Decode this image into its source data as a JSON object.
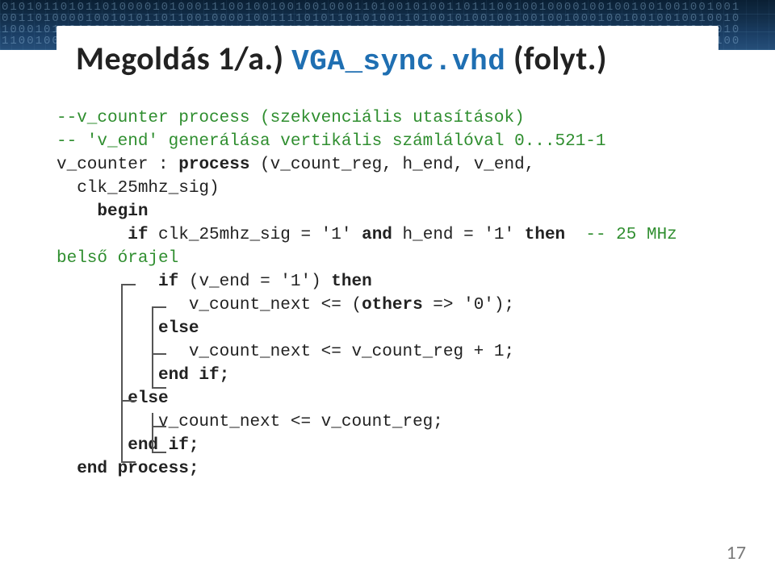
{
  "banner": {
    "digit_rows": [
      "0101011010110100001010001110010010010010001101001010011011100100100001001001001001001001",
      "0011010000100101011011001000010011110101101010011010010100100100100100010010010010010010",
      "1000101001000101001011010001110100100010101001010001000101011001010010010010010010010010",
      "1100100100101101000100000010100100110011010101010001001010110101000100100100100100100100"
    ]
  },
  "title": {
    "prefix": "Megoldás 1/a.)",
    "file": "VGA_sync.vhd",
    "cont": "(folyt.)"
  },
  "code": {
    "c1": "--v_counter process (szekvenciális utasítások)",
    "c2": "-- 'v_end' generálása vertikális számlálóval 0...521-1",
    "l3a": "v_counter : ",
    "l3kw": "process",
    "l3b": " (v_count_reg, h_end, v_end,",
    "l4": "  clk_25mhz_sig)",
    "l5": "    begin",
    "l6a": "       ",
    "l6kw": "if",
    "l6b": " clk_25mhz_sig = '1' ",
    "l6kw2": "and",
    "l6c": " h_end = '1' ",
    "l6kw3": "then",
    "l6cm": "  -- 25 MHz",
    "l7": "belső órajel",
    "l8a": "          ",
    "l8kw": "if",
    "l8b": " (v_end = '1') ",
    "l8kw2": "then",
    "l9a": "             v_count_next <= (",
    "l9kw": "others",
    "l9b": " => '0');",
    "l10": "          else",
    "l11": "             v_count_next <= v_count_reg + 1;",
    "l12": "          end if;",
    "l13": "       else",
    "l14": "          v_count_next <= v_count_reg;",
    "l15": "       end if;",
    "l16": "  end process;"
  },
  "page": "17"
}
